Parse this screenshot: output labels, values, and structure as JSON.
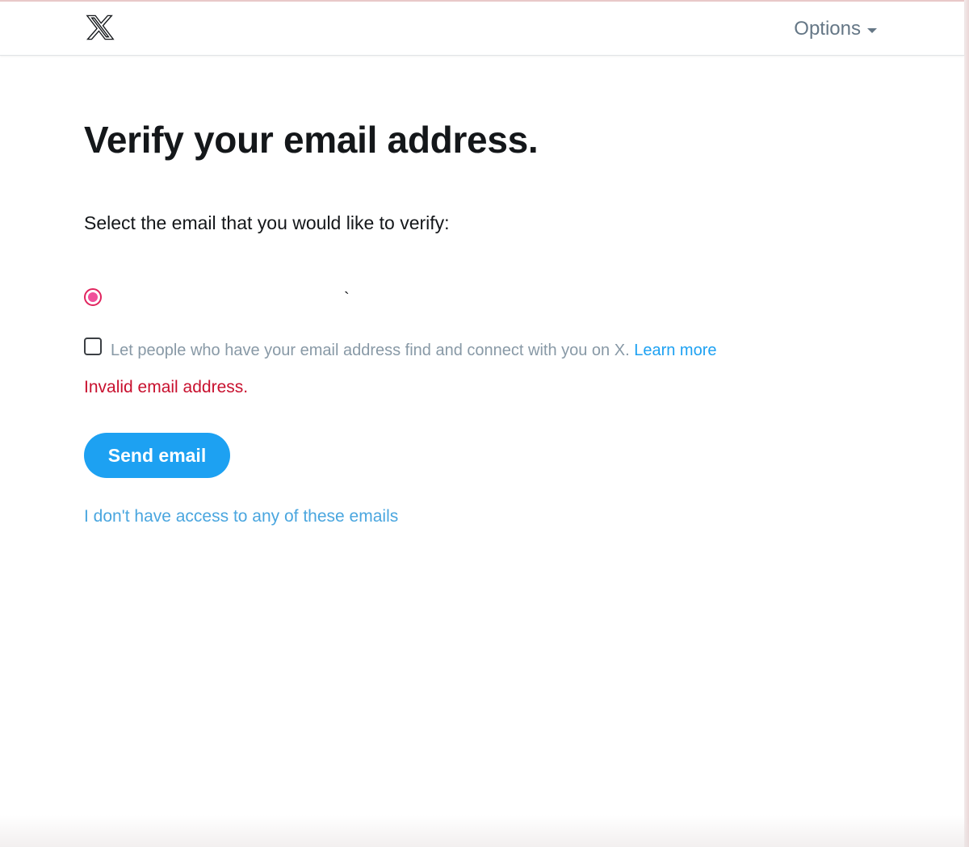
{
  "header": {
    "logo_icon": "x-logo-icon",
    "options_label": "Options",
    "options_icon": "caret-down-icon"
  },
  "main": {
    "title": "Verify your email address.",
    "prompt": "Select the email that you would like to verify:",
    "email_option": {
      "selected": true,
      "label": "`"
    },
    "discoverability": {
      "checked": false,
      "label": "Let people who have your email address find and connect with you on X.",
      "link_label": "Learn more"
    },
    "error_message": "Invalid email address.",
    "send_button_label": "Send email",
    "no_access_link": "I don't have access to any of these emails"
  },
  "colors": {
    "accent": "#1da1f2",
    "error": "#c8102e",
    "radio_selected": "#f0509a",
    "muted_text": "#8899a6",
    "heading": "#14171a"
  }
}
